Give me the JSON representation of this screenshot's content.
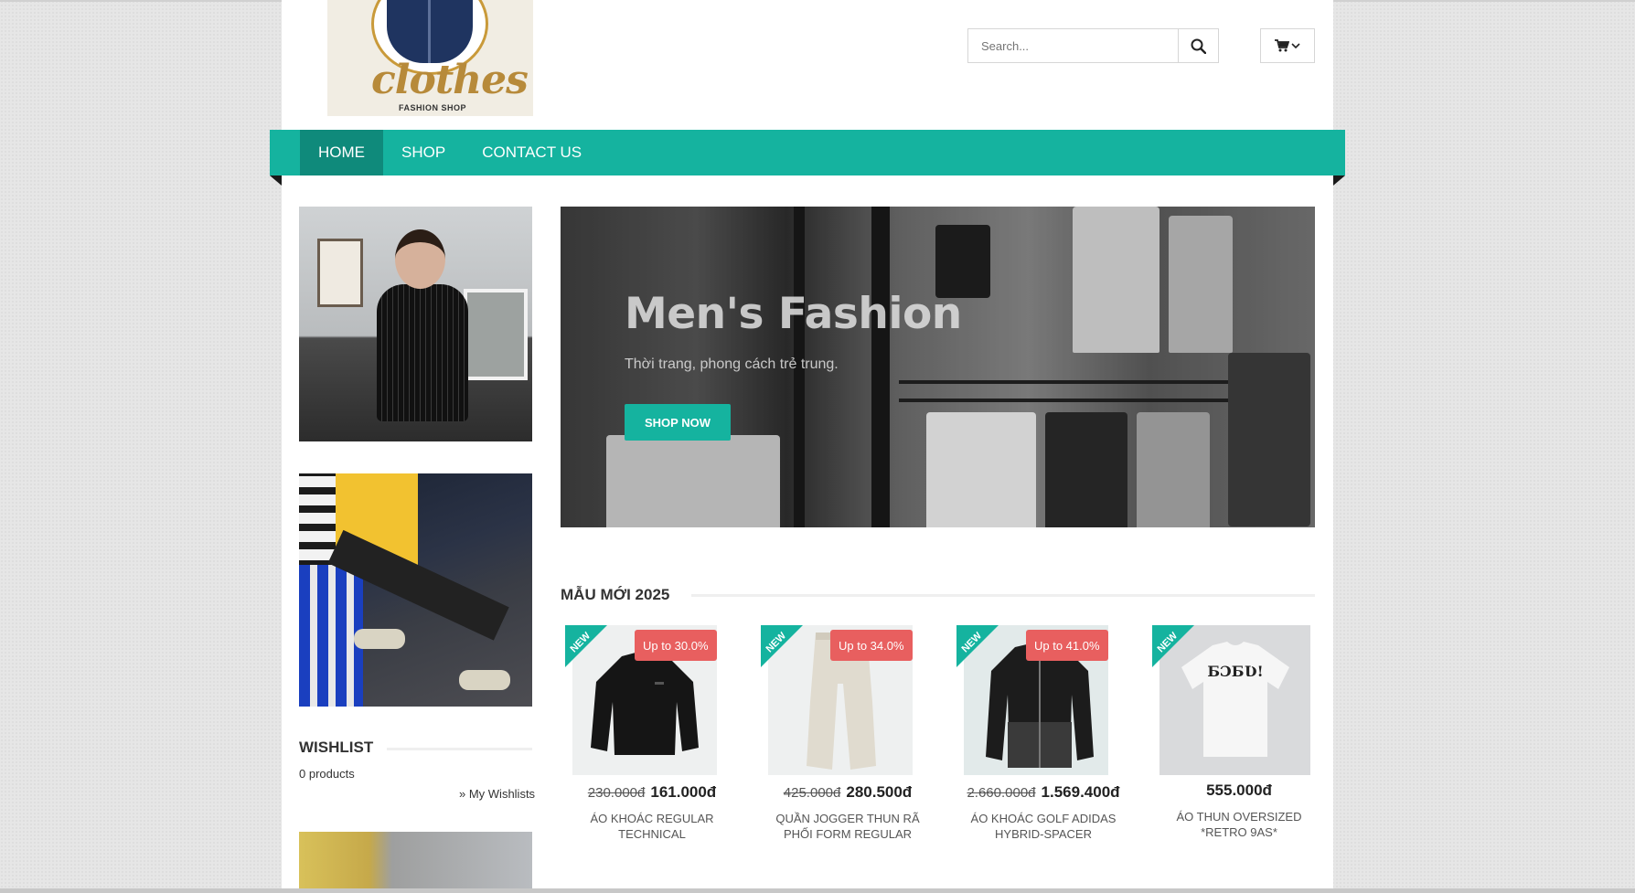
{
  "header": {
    "logo": {
      "brand": "clothes",
      "tagline": "FASHION SHOP"
    },
    "search": {
      "placeholder": "Search...",
      "icon": "search-icon"
    },
    "cart": {
      "icon": "cart-icon",
      "dropdown_icon": "chevron-down-icon"
    }
  },
  "nav": {
    "items": [
      {
        "label": "HOME",
        "active": true
      },
      {
        "label": "SHOP",
        "active": false
      },
      {
        "label": "CONTACT US",
        "active": false
      }
    ],
    "color": "#15b39f",
    "active_color": "#0f8a7b"
  },
  "hero": {
    "title": "Men's Fashion",
    "subtitle": "Thời trang, phong cách trẻ trung.",
    "button": "SHOP NOW"
  },
  "wishlist": {
    "title": "WISHLIST",
    "count": "0 products",
    "link": "» My Wishlists"
  },
  "section": {
    "title": "MẪU MỚI 2025"
  },
  "products": [
    {
      "badge": "NEW",
      "discount": "Up to 30.0%",
      "old_price": "230.000đ",
      "price": "161.000đ",
      "name": "ÁO KHOÁC REGULAR TECHNICAL"
    },
    {
      "badge": "NEW",
      "discount": "Up to 34.0%",
      "old_price": "425.000đ",
      "price": "280.500đ",
      "name": "QUẦN JOGGER THUN RÃ PHỐI FORM REGULAR"
    },
    {
      "badge": "NEW",
      "discount": "Up to 41.0%",
      "old_price": "2.660.000đ",
      "price": "1.569.400đ",
      "name": "ÁO KHOÁC GOLF ADIDAS HYBRID-SPACER"
    },
    {
      "badge": "NEW",
      "discount": "",
      "old_price": "",
      "price": "555.000đ",
      "name": "ÁO THUN OVERSIZED *RETRO 9AS*"
    }
  ],
  "colors": {
    "accent": "#15b39f",
    "discount": "#e85f5f"
  }
}
